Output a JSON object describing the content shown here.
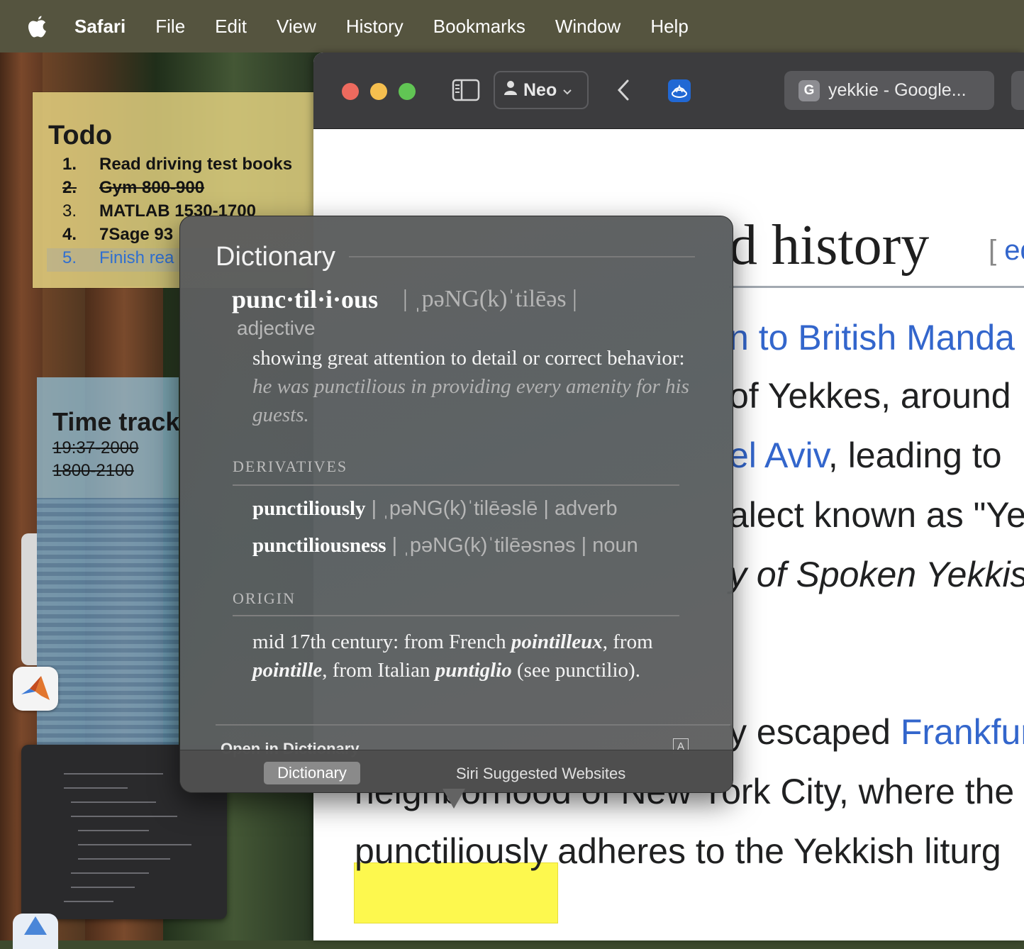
{
  "menubar": {
    "app_name": "Safari",
    "items": [
      "File",
      "Edit",
      "View",
      "History",
      "Bookmarks",
      "Window",
      "Help"
    ]
  },
  "todo_sticky": {
    "title": "Todo",
    "items": [
      {
        "num": "1.",
        "text": "Read driving test books"
      },
      {
        "num": "2.",
        "text": "Gym 800-900"
      },
      {
        "num": "3.",
        "text": "MATLAB 1530-1700"
      },
      {
        "num": "4.",
        "text": "7Sage 93"
      },
      {
        "num": "5.",
        "text": "Finish rea"
      }
    ]
  },
  "time_sticky": {
    "title": "Time track",
    "entries": [
      "19:37-2000",
      "1800-2100"
    ]
  },
  "safari": {
    "profile_label": "Neo",
    "tab_favicon": "G",
    "tab_title": "yekkie - Google...",
    "page": {
      "heading": "d history",
      "edit_open": "[",
      "edit_text": "ed",
      "lines": {
        "l1_link": "n to British Manda",
        "l2": "of Yekkes, around",
        "l3_link": "el Aviv",
        "l3_rest": ", leading to",
        "l4": "alect known as \"Yel",
        "l5": "y of Spoken Yekkis",
        "l6_pre": "y escaped ",
        "l6_link": "Frankfur",
        "l7": "neighborhood of New York City, where the",
        "l8_highlight": "punctiliously",
        "l8_rest": " adheres to the Yekkish liturg"
      }
    }
  },
  "dictionary": {
    "section_title": "Dictionary",
    "headword": "punc·til·i·ous",
    "pronunciation": "| ˌpəNG(k)ˈtilēəs |",
    "part_of_speech": "adjective",
    "definition": "showing great attention to detail or correct behavior: ",
    "example": "he was punctilious in providing every amenity for his guests.",
    "derivatives_label": "DERIVATIVES",
    "derivatives": [
      {
        "word": "punctiliously",
        "rest": " | ˌpəNG(k)ˈtilēəslē | adverb"
      },
      {
        "word": "punctiliousness",
        "rest": " | ˌpəNG(k)ˈtilēəsnəs | noun"
      }
    ],
    "origin_label": "ORIGIN",
    "origin": {
      "p1": "mid 17th century: from French ",
      "w1": "pointilleux",
      "p2": ", from ",
      "w2": "pointille",
      "p3": ", from Italian ",
      "w3": "puntiglio",
      "p4": " (see punctilio)."
    },
    "open_link": "Open in Dictionary",
    "tabs": [
      "Dictionary",
      "Siri Suggested Websites"
    ]
  }
}
